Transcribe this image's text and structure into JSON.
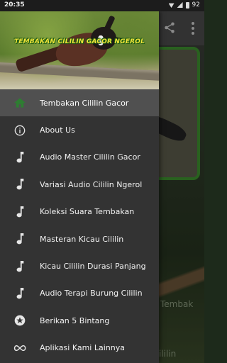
{
  "status_bar": {
    "time": "20:35",
    "battery": "92"
  },
  "header": {
    "title": "TEMBAKAN CILILIN GACOR NGEROL"
  },
  "menu": {
    "items": [
      {
        "label": "Tembakan Cililin Gacor",
        "icon": "home-icon",
        "active": true
      },
      {
        "label": "About Us",
        "icon": "info-icon"
      },
      {
        "label": "Audio Master Cililin Gacor",
        "icon": "music-note-icon"
      },
      {
        "label": "Variasi Audio Cililin Ngerol",
        "icon": "music-note-icon"
      },
      {
        "label": "Koleksi Suara Tembakan",
        "icon": "music-note-icon"
      },
      {
        "label": "Masteran Kicau Cililin",
        "icon": "music-note-icon"
      },
      {
        "label": "Kicau Cililin Durasi Panjang",
        "icon": "music-note-icon"
      },
      {
        "label": "Audio Terapi Burung Cililin",
        "icon": "music-note-icon"
      },
      {
        "label": "Berikan 5 Bintang",
        "icon": "star-icon"
      },
      {
        "label": "Aplikasi Kami Lainnya",
        "icon": "infinity-icon"
      }
    ]
  },
  "background": {
    "text_1": "Tembak",
    "text_2": "ililin"
  },
  "colors": {
    "drawer": "#333333",
    "active_item": "#505050",
    "home_icon": "#2e7d32",
    "card_border": "#3d8f2e"
  }
}
